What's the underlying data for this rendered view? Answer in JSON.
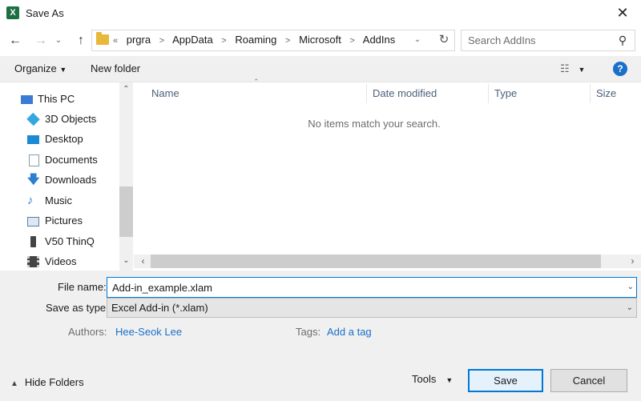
{
  "window": {
    "title": "Save As",
    "app_icon": "X",
    "close": "✕"
  },
  "address": {
    "crumbs": [
      "prgra",
      "AppData",
      "Roaming",
      "Microsoft",
      "AddIns"
    ],
    "prefix": "«"
  },
  "search": {
    "placeholder": "Search AddIns"
  },
  "toolbar": {
    "organize": "Organize",
    "new_folder": "New folder",
    "help": "?"
  },
  "nav": {
    "items": [
      {
        "label": "This PC",
        "icon": "this-pc-icon",
        "color": "#3a7bd5"
      },
      {
        "label": "3D Objects",
        "icon": "3d-objects-icon",
        "color": "#33a8e0"
      },
      {
        "label": "Desktop",
        "icon": "desktop-icon",
        "color": "#1a8ad4"
      },
      {
        "label": "Documents",
        "icon": "documents-icon",
        "color": "#8c9aa8"
      },
      {
        "label": "Downloads",
        "icon": "downloads-icon",
        "color": "#2b7fd2"
      },
      {
        "label": "Music",
        "icon": "music-icon",
        "color": "#2b7fd2"
      },
      {
        "label": "Pictures",
        "icon": "pictures-icon",
        "color": "#5b7fa6"
      },
      {
        "label": "V50 ThinQ",
        "icon": "phone-icon",
        "color": "#444444"
      },
      {
        "label": "Videos",
        "icon": "videos-icon",
        "color": "#444444"
      }
    ]
  },
  "filelist": {
    "columns": [
      "Name",
      "Date modified",
      "Type",
      "Size"
    ],
    "empty_message": "No items match your search."
  },
  "form": {
    "file_name_label": "File name:",
    "file_name_value": "Add-in_example.xlam",
    "save_as_type_label": "Save as type:",
    "save_as_type_value": "Excel Add-in (*.xlam)",
    "authors_label": "Authors:",
    "authors_value": "Hee-Seok Lee",
    "tags_label": "Tags:",
    "tags_value": "Add a tag"
  },
  "footer": {
    "hide_folders": "Hide Folders",
    "tools": "Tools",
    "save": "Save",
    "cancel": "Cancel"
  },
  "colors": {
    "accent": "#0078d7",
    "link": "#1a6fc9",
    "excel_green": "#1d6f42"
  }
}
